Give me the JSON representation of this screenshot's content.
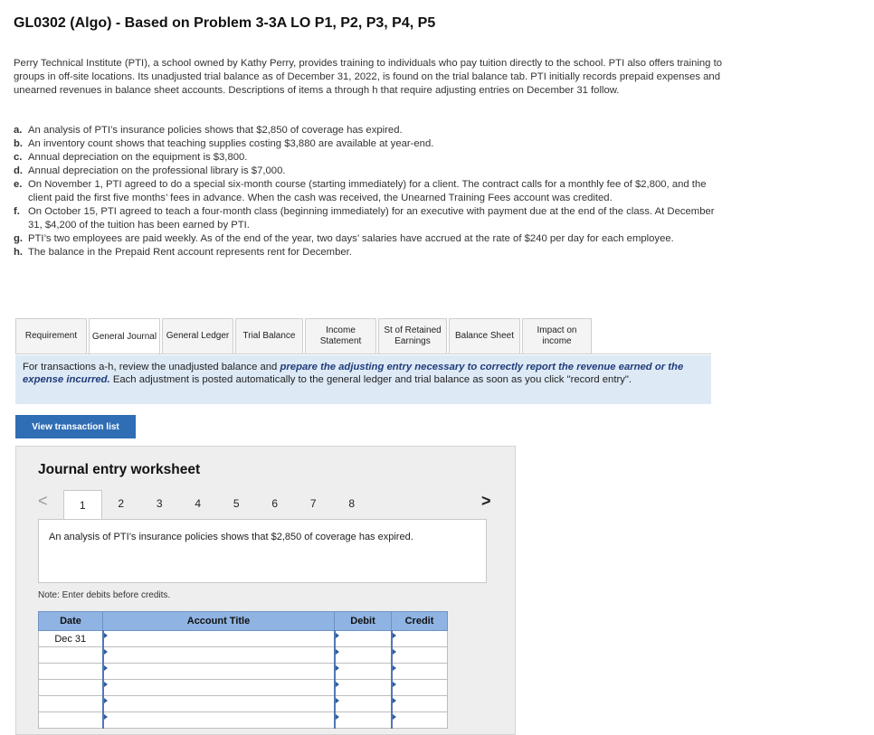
{
  "page": {
    "title": "GL0302 (Algo) - Based on Problem 3-3A LO P1, P2, P3, P4, P5",
    "intro": "Perry Technical Institute (PTI), a school owned by Kathy Perry, provides training to individuals who pay tuition directly to the school. PTI also offers training to groups in off-site locations. Its unadjusted trial balance as of December 31, 2022, is found on the trial balance tab. PTI initially records prepaid expenses and unearned revenues in balance sheet accounts. Descriptions of items a through h that require adjusting entries on December 31 follow."
  },
  "items": [
    {
      "letter": "a.",
      "text": "An analysis of PTI’s insurance policies shows that $2,850 of coverage has expired."
    },
    {
      "letter": "b.",
      "text": "An inventory count shows that teaching supplies costing $3,880 are available at year-end."
    },
    {
      "letter": "c.",
      "text": "Annual depreciation on the equipment is $3,800."
    },
    {
      "letter": "d.",
      "text": "Annual depreciation on the professional library is $7,000."
    },
    {
      "letter": "e.",
      "text": "On November 1, PTI agreed to do a special six-month course (starting immediately) for a client. The contract calls for a monthly fee of $2,800, and the client paid the first five months’ fees in advance. When the cash was received, the Unearned Training Fees account was credited."
    },
    {
      "letter": "f.",
      "text": "On October 15, PTI agreed to teach a four-month class (beginning immediately) for an executive with payment due at the end of the class. At December 31, $4,200 of the tuition has been earned by PTI."
    },
    {
      "letter": "g.",
      "text": "PTI’s two employees are paid weekly. As of the end of the year, two days’ salaries have accrued at the rate of $240 per day for each employee."
    },
    {
      "letter": "h.",
      "text": "The balance in the Prepaid Rent account represents rent for December."
    }
  ],
  "tabs": [
    {
      "label": "Requirement"
    },
    {
      "label": "General Journal"
    },
    {
      "label": "General Ledger"
    },
    {
      "label": "Trial Balance"
    },
    {
      "label": "Income Statement"
    },
    {
      "label": "St of Retained Earnings"
    },
    {
      "label": "Balance Sheet"
    },
    {
      "label": "Impact on income"
    }
  ],
  "instructions": {
    "pre": "For transactions a-h, review the unadjusted balance and ",
    "highlight": "prepare the adjusting entry necessary to correctly report the revenue earned or the expense incurred.",
    "post": " Each adjustment is posted automatically to the general ledger and trial balance as soon as you click \"record entry\"."
  },
  "view_transactions_label": "View transaction list",
  "worksheet": {
    "title": "Journal entry worksheet",
    "prev_glyph": "<",
    "next_glyph": ">",
    "pages": [
      "1",
      "2",
      "3",
      "4",
      "5",
      "6",
      "7",
      "8"
    ],
    "active_page": "1",
    "description": "An analysis of PTI’s insurance policies shows that $2,850 of coverage has expired.",
    "note": "Note: Enter debits before credits.",
    "columns": [
      "Date",
      "Account Title",
      "Debit",
      "Credit"
    ],
    "rows": [
      {
        "date": "Dec 31"
      },
      {
        "date": ""
      },
      {
        "date": ""
      },
      {
        "date": ""
      },
      {
        "date": ""
      },
      {
        "date": ""
      }
    ]
  }
}
